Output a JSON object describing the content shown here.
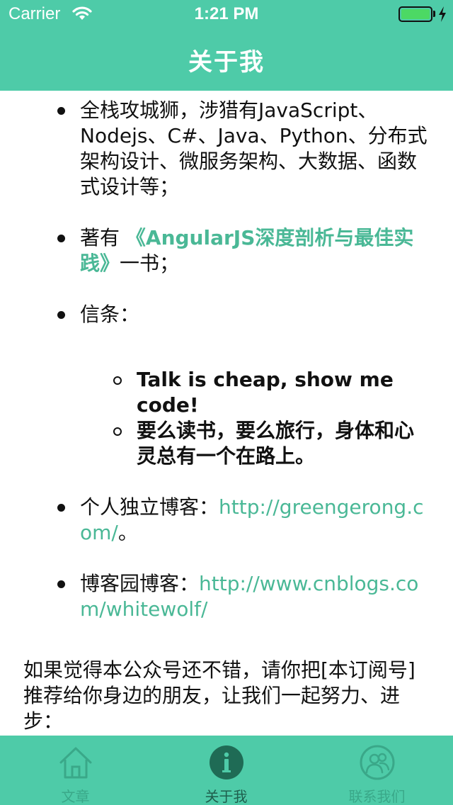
{
  "status_bar": {
    "carrier": "Carrier",
    "time": "1:21 PM",
    "battery_level": 1.0
  },
  "nav": {
    "title": "关于我"
  },
  "content": {
    "item1": "全栈攻城狮，涉猎有JavaScript、Nodejs、C#、Java、Python、分布式架构设计、微服务架构、大数据、函数式设计等；",
    "item2_prefix": "著有 ",
    "item2_book": "《AngularJS深度剖析与最佳实践》",
    "item2_suffix": "一书；",
    "item3": "信条：",
    "motto1": "Talk is cheap, show me code!",
    "motto2": "要么读书，要么旅行，身体和心灵总有一个在路上。",
    "item4_prefix": "个人独立博客：",
    "item4_link": "http://greengerong.com/",
    "item4_suffix": "。",
    "item5_prefix": "博客园博客：",
    "item5_link": "http://www.cnblogs.com/whitewolf/",
    "closing": "如果觉得本公众号还不错，请你把[本订阅号]推荐给你身边的朋友，让我们一起努力、进步："
  },
  "tabs": [
    {
      "label": "文章",
      "icon": "home-icon"
    },
    {
      "label": "关于我",
      "icon": "info-icon",
      "active": true
    },
    {
      "label": "联系我们",
      "icon": "contacts-icon"
    }
  ],
  "colors": {
    "accent": "#4ecba8",
    "link": "#4ab896",
    "tab_inactive": "#3aa889"
  }
}
